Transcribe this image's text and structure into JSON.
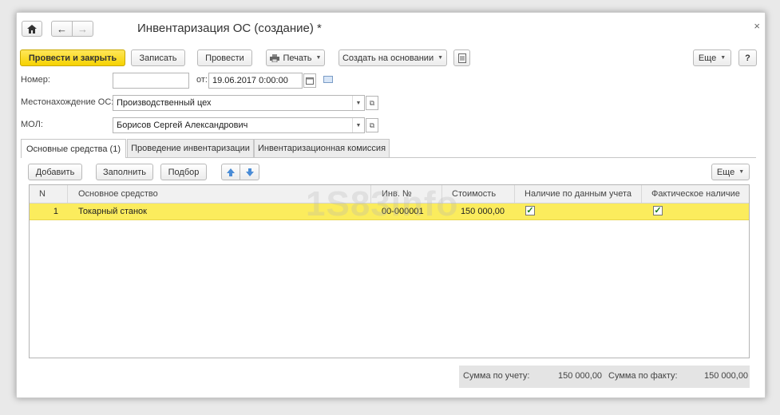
{
  "window": {
    "title": "Инвентаризация ОС (создание) *",
    "close_glyph": "×"
  },
  "toolbar": {
    "post_close": "Провести и закрыть",
    "write": "Записать",
    "post": "Провести",
    "print": "Печать",
    "create_based": "Создать на основании",
    "more": "Еще",
    "help": "?"
  },
  "form": {
    "number_label": "Номер:",
    "number_value": "",
    "date_label": "от:",
    "date_value": "19.06.2017  0:00:00",
    "location_label": "Местонахождение ОС:",
    "location_value": "Производственный цех",
    "mol_label": "МОЛ:",
    "mol_value": "Борисов Сергей Александрович"
  },
  "tabs": [
    {
      "label": "Основные средства (1)"
    },
    {
      "label": "Проведение инвентаризации"
    },
    {
      "label": "Инвентаризационная комиссия"
    }
  ],
  "table_toolbar": {
    "add": "Добавить",
    "fill": "Заполнить",
    "select": "Подбор",
    "more": "Еще"
  },
  "table": {
    "columns": [
      "N",
      "Основное средство",
      "Инв. №",
      "Стоимость",
      "Наличие по данным учета",
      "Фактическое наличие"
    ],
    "rows": [
      {
        "n": "1",
        "asset": "Токарный станок",
        "inv": "00-000001",
        "cost": "150 000,00",
        "accounted": true,
        "actual": true
      }
    ]
  },
  "watermark": "1S83info",
  "totals": {
    "accounted_label": "Сумма по учету:",
    "accounted_value": "150 000,00",
    "actual_label": "Сумма по факту:",
    "actual_value": "150 000,00"
  },
  "icons": [
    "home-icon",
    "back-arrow-icon",
    "forward-arrow-icon",
    "printer-icon",
    "report-icon",
    "calendar-icon",
    "comment-icon",
    "open-icon",
    "move-up-icon",
    "move-down-icon",
    "checkbox-checked-icon"
  ]
}
